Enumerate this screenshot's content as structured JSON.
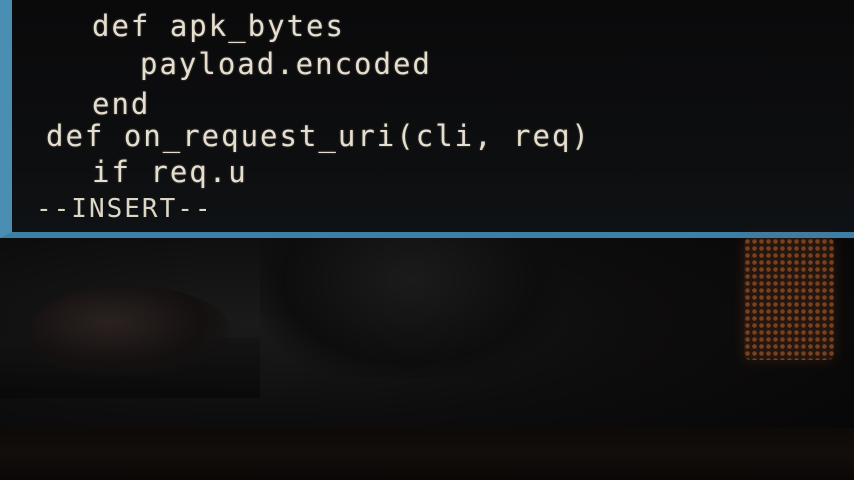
{
  "terminal": {
    "code_lines": [
      "def apk_bytes",
      "payload.encoded",
      "end",
      "def on_request_uri(cli, req)",
      "if req.u"
    ],
    "mode_indicator": "--INSERT--",
    "accent_color": "#4a8fb3",
    "text_color": "#e6dfcf"
  },
  "scene": {
    "speaker_glow_color": "#8a4a22"
  }
}
